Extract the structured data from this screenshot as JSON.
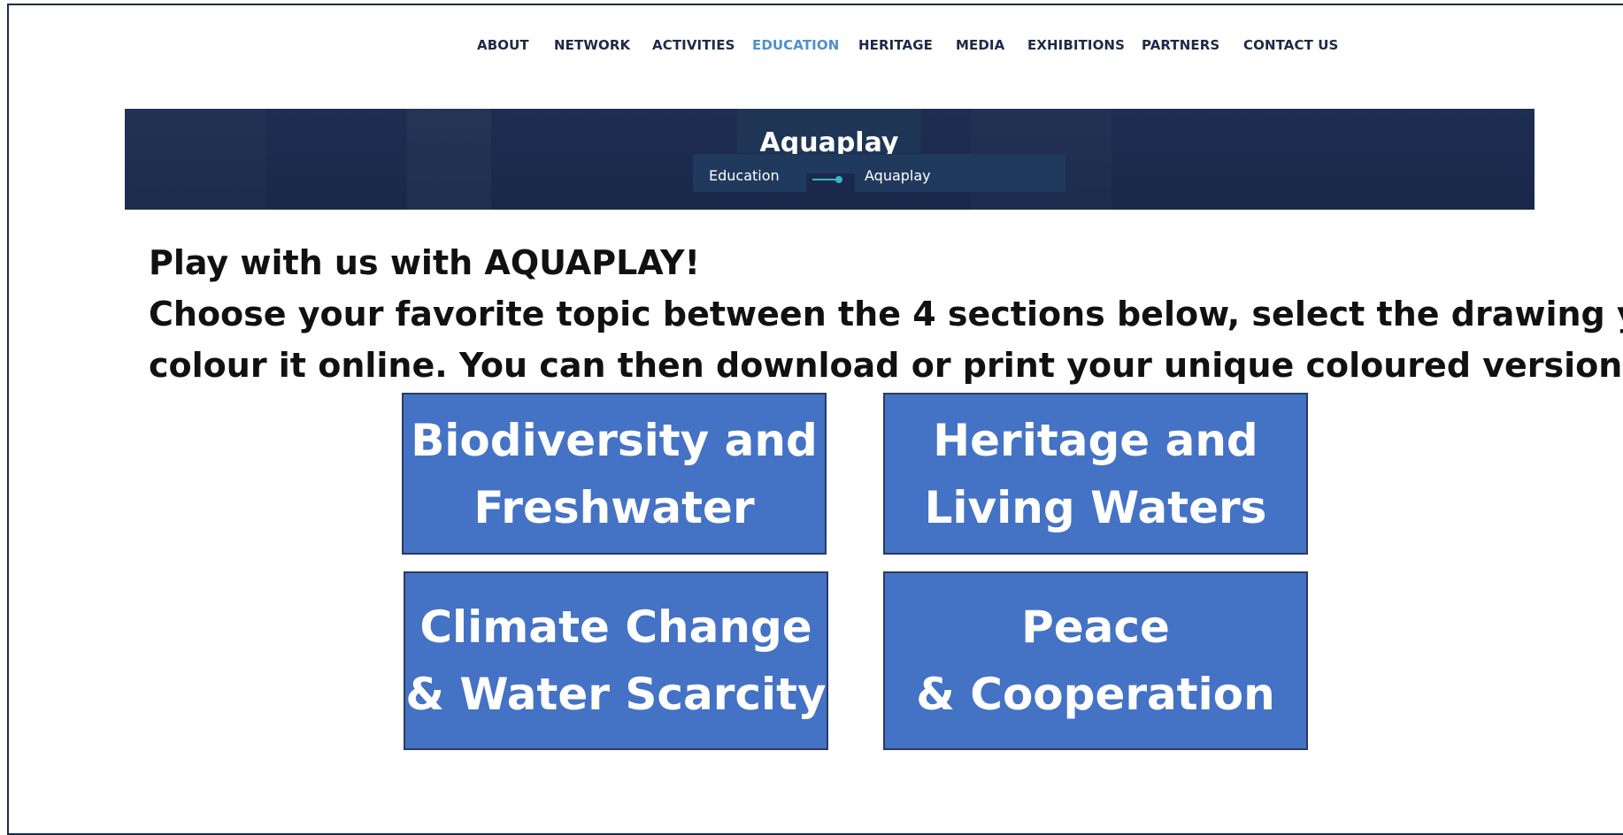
{
  "nav": {
    "items": [
      {
        "label": "ABOUT",
        "active": false
      },
      {
        "label": "NETWORK",
        "active": false
      },
      {
        "label": "ACTIVITIES",
        "active": false
      },
      {
        "label": "EDUCATION",
        "active": true
      },
      {
        "label": "HERITAGE",
        "active": false
      },
      {
        "label": "MEDIA",
        "active": false
      },
      {
        "label": "EXHIBITIONS",
        "active": false
      },
      {
        "label": "PARTNERS",
        "active": false
      },
      {
        "label": "CONTACT US",
        "active": false
      }
    ]
  },
  "banner": {
    "title": "Aquaplay",
    "breadcrumb": [
      "Education",
      "Aquaplay"
    ]
  },
  "intro": {
    "line1": "Play with us with AQUAPLAY!",
    "line2": "Choose your favorite topic between the 4 sections below, select the drawing you pre",
    "line3": "colour it online. You can then download or print your unique coloured version of the"
  },
  "sections": [
    {
      "line1": "Biodiversity and",
      "line2": "Freshwater"
    },
    {
      "line1": "Heritage  and",
      "line2": "Living Waters"
    },
    {
      "line1": "Climate Change",
      "line2": "& Water Scarcity"
    },
    {
      "line1": "Peace",
      "line2": "& Cooperation"
    }
  ],
  "colors": {
    "accent": "#4f8fd1",
    "banner": "#1b2a4c",
    "tile": "#4472c4",
    "breadcrumb_separator": "#35b6c9"
  }
}
